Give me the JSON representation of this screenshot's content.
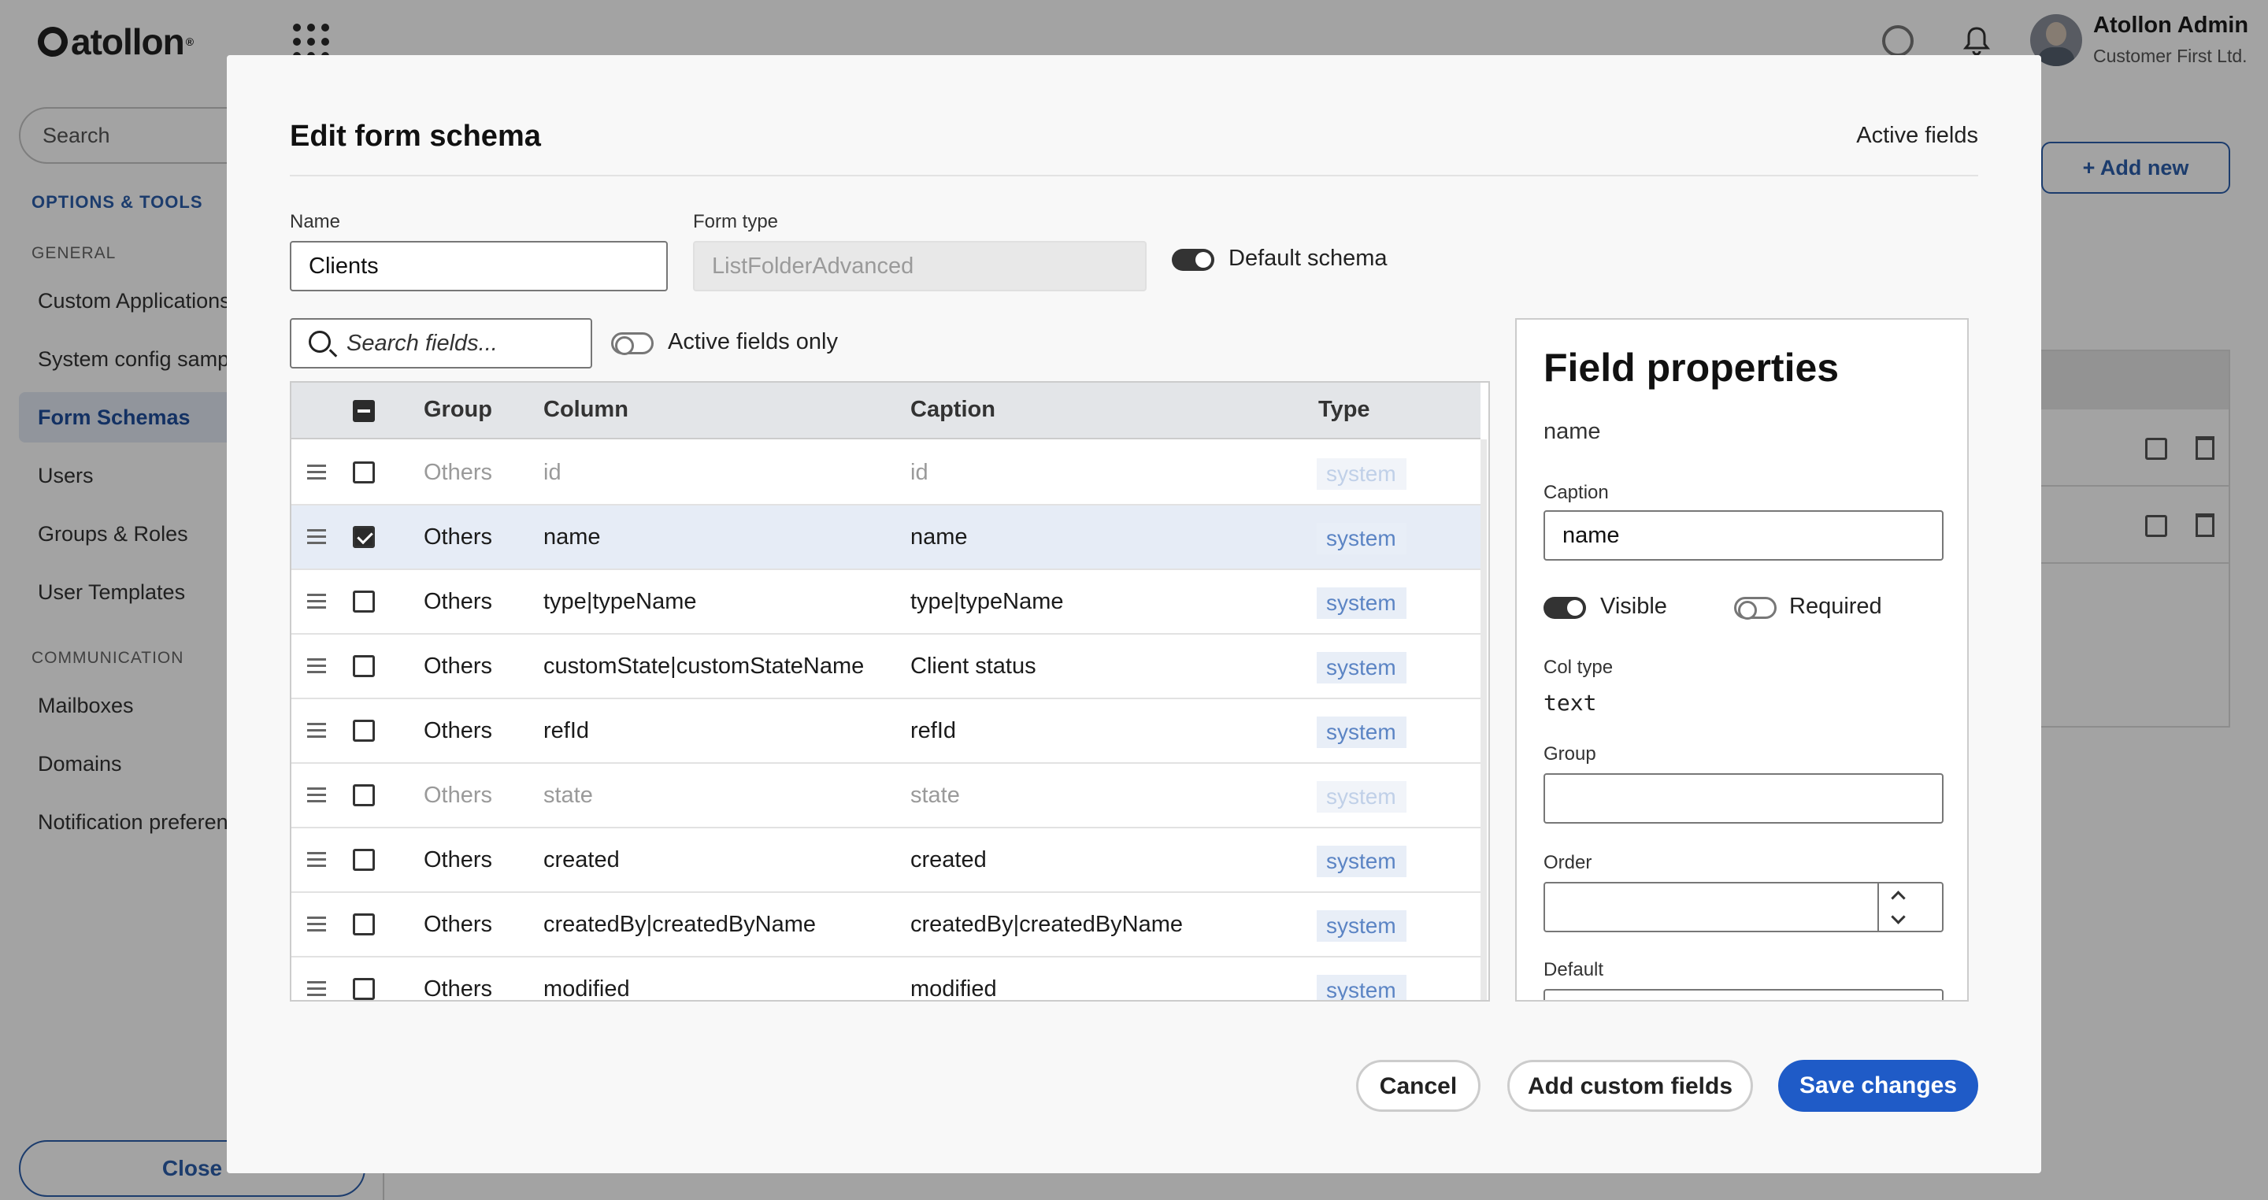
{
  "app": {
    "logo_text": "atollon",
    "user_name": "Atollon Admin",
    "user_org": "Customer First Ltd."
  },
  "sidebar": {
    "search_placeholder": "Search",
    "section_title": "OPTIONS & TOOLS",
    "groups": [
      {
        "title": "GENERAL"
      },
      {
        "title": "COMMUNICATION"
      }
    ],
    "items": [
      {
        "label": "Custom Applications"
      },
      {
        "label": "System config samples"
      },
      {
        "label": "Form Schemas",
        "active": true
      },
      {
        "label": "Users"
      },
      {
        "label": "Groups & Roles"
      },
      {
        "label": "User Templates"
      },
      {
        "label": "Mailboxes"
      },
      {
        "label": "Domains"
      },
      {
        "label": "Notification preferences"
      }
    ],
    "close_label": "Close"
  },
  "main": {
    "add_new_label": "+ Add new"
  },
  "modal": {
    "title": "Edit form schema",
    "active_fields_link": "Active fields",
    "name_label": "Name",
    "name_value": "Clients",
    "form_type_label": "Form type",
    "form_type_value": "ListFolderAdvanced",
    "default_schema_label": "Default schema",
    "default_schema_on": true,
    "search_placeholder": "Search fields...",
    "active_only_label": "Active fields only",
    "active_only_on": false,
    "table": {
      "columns": [
        "Group",
        "Column",
        "Caption",
        "Type"
      ],
      "rows": [
        {
          "group": "Others",
          "column": "id",
          "caption": "id",
          "type": "system",
          "checked": false,
          "dim": true
        },
        {
          "group": "Others",
          "column": "name",
          "caption": "name",
          "type": "system",
          "checked": true,
          "dim": false,
          "selected": true
        },
        {
          "group": "Others",
          "column": "type|typeName",
          "caption": "type|typeName",
          "type": "system",
          "checked": false,
          "dim": false
        },
        {
          "group": "Others",
          "column": "customState|customStateName",
          "caption": "Client status",
          "type": "system",
          "checked": false,
          "dim": false
        },
        {
          "group": "Others",
          "column": "refId",
          "caption": "refId",
          "type": "system",
          "checked": false,
          "dim": false
        },
        {
          "group": "Others",
          "column": "state",
          "caption": "state",
          "type": "system",
          "checked": false,
          "dim": true
        },
        {
          "group": "Others",
          "column": "created",
          "caption": "created",
          "type": "system",
          "checked": false,
          "dim": false
        },
        {
          "group": "Others",
          "column": "createdBy|createdByName",
          "caption": "createdBy|createdByName",
          "type": "system",
          "checked": false,
          "dim": false
        },
        {
          "group": "Others",
          "column": "modified",
          "caption": "modified",
          "type": "system",
          "checked": false,
          "dim": false
        }
      ]
    },
    "field_properties": {
      "title": "Field properties",
      "field_name": "name",
      "caption_label": "Caption",
      "caption_value": "name",
      "visible_label": "Visible",
      "visible_on": true,
      "required_label": "Required",
      "required_on": false,
      "col_type_label": "Col type",
      "col_type_value": "text",
      "group_label": "Group",
      "group_value": "",
      "order_label": "Order",
      "order_value": "",
      "default_label": "Default"
    },
    "buttons": {
      "cancel": "Cancel",
      "add_custom": "Add custom fields",
      "save": "Save changes"
    }
  }
}
